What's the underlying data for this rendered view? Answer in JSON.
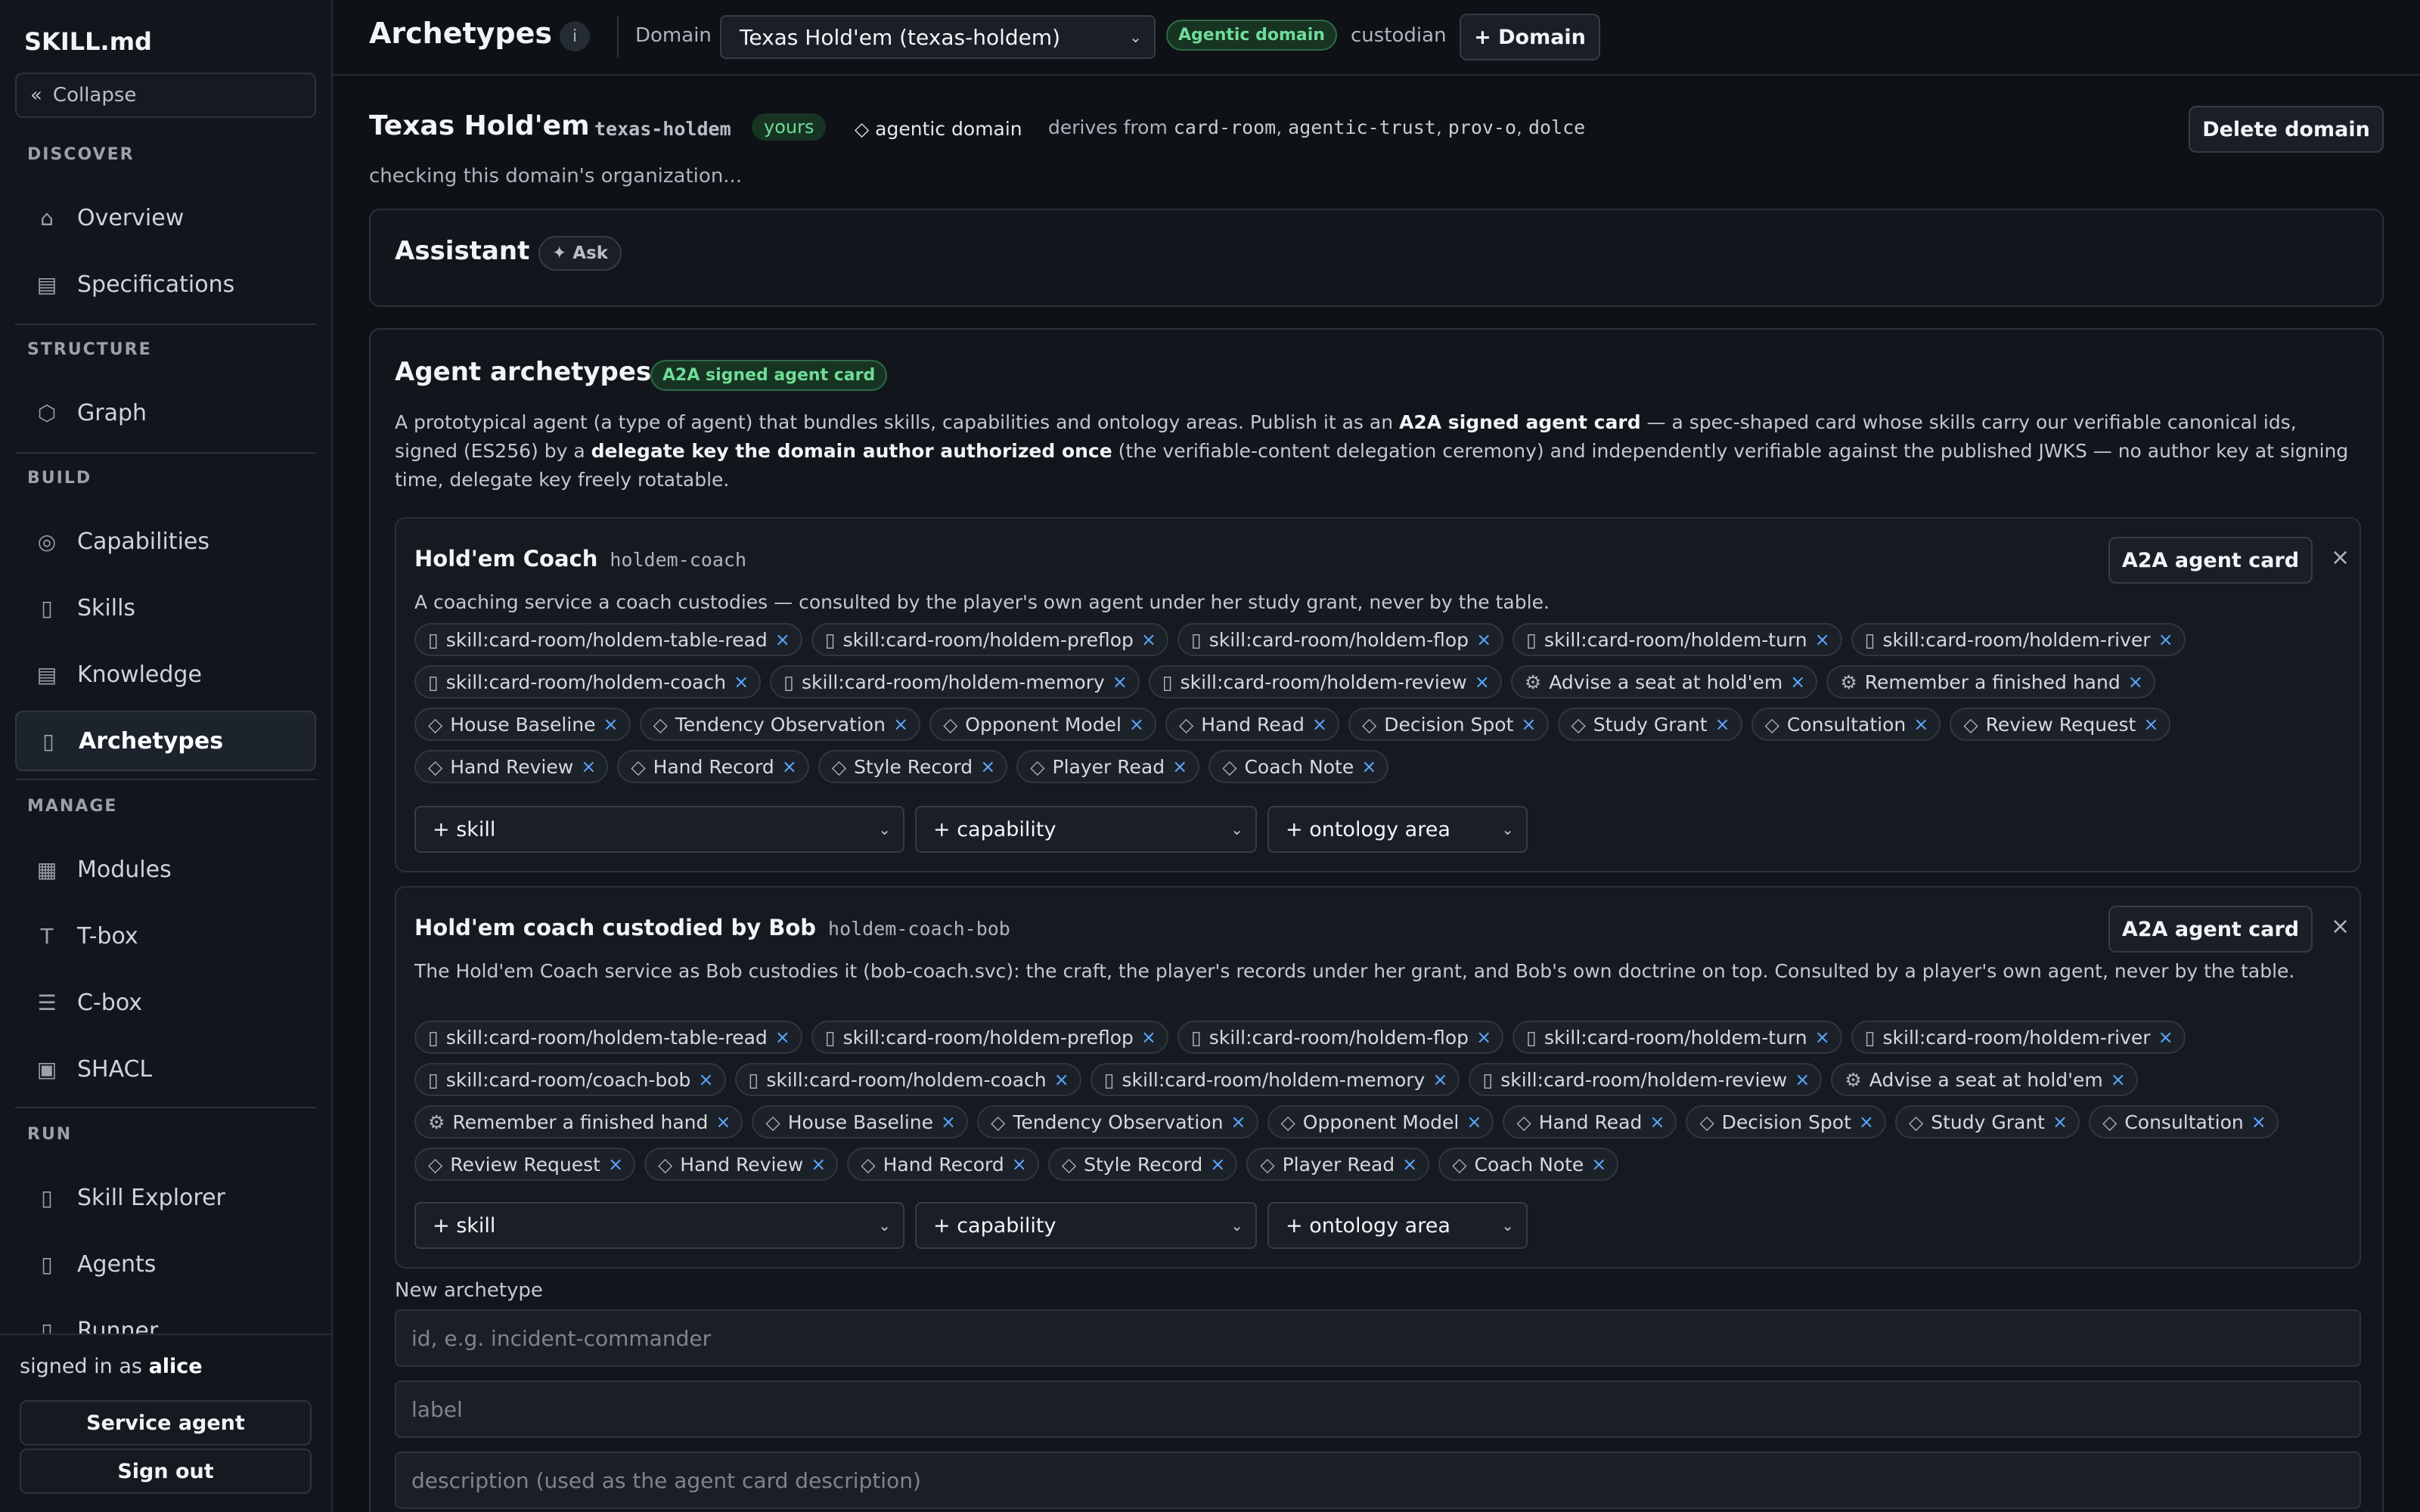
{
  "app": {
    "brand": "SKILL.md",
    "collapse_label": "Collapse",
    "collapse_glyph": "«"
  },
  "sidebar": {
    "sections": [
      {
        "title": "DISCOVER",
        "items": [
          {
            "label": "Overview",
            "icon": "⌂",
            "icon_name": "home-icon"
          },
          {
            "label": "Specifications",
            "icon": "▤",
            "icon_name": "document-icon"
          }
        ]
      },
      {
        "title": "STRUCTURE",
        "items": [
          {
            "label": "Graph",
            "icon": "⬡",
            "icon_name": "graph-icon"
          }
        ]
      },
      {
        "title": "BUILD",
        "items": [
          {
            "label": "Capabilities",
            "icon": "◎",
            "icon_name": "target-icon"
          },
          {
            "label": "Skills",
            "icon": "▯",
            "icon_name": "skills-icon"
          },
          {
            "label": "Knowledge",
            "icon": "▤",
            "icon_name": "book-icon"
          },
          {
            "label": "Archetypes",
            "icon": "▯",
            "icon_name": "archetype-icon",
            "active": true
          }
        ]
      },
      {
        "title": "MANAGE",
        "items": [
          {
            "label": "Modules",
            "icon": "▦",
            "icon_name": "grid-icon"
          },
          {
            "label": "T-box",
            "icon": "T",
            "icon_name": "tbox-icon"
          },
          {
            "label": "C-box",
            "icon": "☰",
            "icon_name": "list-icon"
          },
          {
            "label": "SHACL",
            "icon": "▣",
            "icon_name": "shape-icon"
          }
        ]
      },
      {
        "title": "RUN",
        "items": [
          {
            "label": "Skill Explorer",
            "icon": "▯",
            "icon_name": "explorer-icon"
          },
          {
            "label": "Agents",
            "icon": "▯",
            "icon_name": "agents-icon"
          },
          {
            "label": "Runner",
            "icon": "▯",
            "icon_name": "runner-icon"
          }
        ]
      }
    ],
    "footer": {
      "signed_in_prefix": "signed in as",
      "user": "alice",
      "service_agent": "Service agent",
      "sign_out": "Sign out"
    }
  },
  "topbar": {
    "title": "Archetypes",
    "info": "i",
    "domain_label": "Domain",
    "domain_value": "Texas Hold'em (texas-holdem)",
    "agentic_badge": "Agentic domain",
    "custodian": "custodian",
    "add_domain": "+ Domain"
  },
  "domain": {
    "title": "Texas Hold'em",
    "id": "texas-holdem",
    "yours": "yours",
    "agentic": "◇ agentic domain",
    "derives_prefix": "derives from",
    "derives": [
      "card-room",
      "agentic-trust",
      "prov-o",
      "dolce"
    ],
    "delete": "Delete domain",
    "checking": "checking this domain's organization..."
  },
  "assistant": {
    "title": "Assistant",
    "ask": "Ask",
    "ask_glyph": "✦"
  },
  "archetypes": {
    "title": "Agent archetypes",
    "badge": "A2A signed agent card",
    "desc_parts": [
      "A prototypical agent (a type of agent) that bundles skills, capabilities and ontology areas. Publish it as an ",
      "A2A signed agent card",
      " — a spec-shaped card whose skills carry our verifiable canonical ids, signed (ES256) by a ",
      "delegate key the domain author authorized once",
      " (the verifiable-content delegation ceremony) and independently verifiable against the published JWKS — no author key at signing time, delegate key freely rotatable."
    ],
    "cards": [
      {
        "name": "Hold'em Coach",
        "id": "holdem-coach",
        "a2a": "A2A agent card",
        "close": "×",
        "description": "A coaching service a coach custodies — consulted by the player's own agent under her study grant, never by the table.",
        "chips": [
          {
            "g": "▯",
            "t": "skill:card-room/holdem-table-read"
          },
          {
            "g": "▯",
            "t": "skill:card-room/holdem-preflop"
          },
          {
            "g": "▯",
            "t": "skill:card-room/holdem-flop"
          },
          {
            "g": "▯",
            "t": "skill:card-room/holdem-turn"
          },
          {
            "g": "▯",
            "t": "skill:card-room/holdem-river"
          },
          {
            "g": "▯",
            "t": "skill:card-room/holdem-coach"
          },
          {
            "g": "▯",
            "t": "skill:card-room/holdem-memory"
          },
          {
            "g": "▯",
            "t": "skill:card-room/holdem-review"
          },
          {
            "g": "⚙",
            "t": "Advise a seat at hold'em"
          },
          {
            "g": "⚙",
            "t": "Remember a finished hand"
          },
          {
            "g": "◇",
            "t": "House Baseline"
          },
          {
            "g": "◇",
            "t": "Tendency Observation"
          },
          {
            "g": "◇",
            "t": "Opponent Model"
          },
          {
            "g": "◇",
            "t": "Hand Read"
          },
          {
            "g": "◇",
            "t": "Decision Spot"
          },
          {
            "g": "◇",
            "t": "Study Grant"
          },
          {
            "g": "◇",
            "t": "Consultation"
          },
          {
            "g": "◇",
            "t": "Review Request"
          },
          {
            "g": "◇",
            "t": "Hand Review"
          },
          {
            "g": "◇",
            "t": "Hand Record"
          },
          {
            "g": "◇",
            "t": "Style Record"
          },
          {
            "g": "◇",
            "t": "Player Read"
          },
          {
            "g": "◇",
            "t": "Coach Note"
          }
        ],
        "selects": [
          "+ skill",
          "+ capability",
          "+ ontology area"
        ]
      },
      {
        "name": "Hold'em coach custodied by Bob",
        "id": "holdem-coach-bob",
        "a2a": "A2A agent card",
        "close": "×",
        "description": "The Hold'em Coach service as Bob custodies it (bob-coach.svc): the craft, the player's records under her grant, and Bob's own doctrine on top. Consulted by a player's own agent, never by the table.",
        "chips": [
          {
            "g": "▯",
            "t": "skill:card-room/holdem-table-read"
          },
          {
            "g": "▯",
            "t": "skill:card-room/holdem-preflop"
          },
          {
            "g": "▯",
            "t": "skill:card-room/holdem-flop"
          },
          {
            "g": "▯",
            "t": "skill:card-room/holdem-turn"
          },
          {
            "g": "▯",
            "t": "skill:card-room/holdem-river"
          },
          {
            "g": "▯",
            "t": "skill:card-room/coach-bob"
          },
          {
            "g": "▯",
            "t": "skill:card-room/holdem-coach"
          },
          {
            "g": "▯",
            "t": "skill:card-room/holdem-memory"
          },
          {
            "g": "▯",
            "t": "skill:card-room/holdem-review"
          },
          {
            "g": "⚙",
            "t": "Advise a seat at hold'em"
          },
          {
            "g": "⚙",
            "t": "Remember a finished hand"
          },
          {
            "g": "◇",
            "t": "House Baseline"
          },
          {
            "g": "◇",
            "t": "Tendency Observation"
          },
          {
            "g": "◇",
            "t": "Opponent Model"
          },
          {
            "g": "◇",
            "t": "Hand Read"
          },
          {
            "g": "◇",
            "t": "Decision Spot"
          },
          {
            "g": "◇",
            "t": "Study Grant"
          },
          {
            "g": "◇",
            "t": "Consultation"
          },
          {
            "g": "◇",
            "t": "Review Request"
          },
          {
            "g": "◇",
            "t": "Hand Review"
          },
          {
            "g": "◇",
            "t": "Hand Record"
          },
          {
            "g": "◇",
            "t": "Style Record"
          },
          {
            "g": "◇",
            "t": "Player Read"
          },
          {
            "g": "◇",
            "t": "Coach Note"
          }
        ],
        "selects": [
          "+ skill",
          "+ capability",
          "+ ontology area"
        ]
      }
    ],
    "new": {
      "label": "New archetype",
      "id_placeholder": "id, e.g. incident-commander",
      "label_placeholder": "label",
      "desc_placeholder": "description (used as the agent card description)"
    }
  },
  "colors": {
    "background": "#0e1116",
    "panel": "#12161c",
    "accent_green": "#6fdc98",
    "remove_blue": "#5aa8ff"
  }
}
